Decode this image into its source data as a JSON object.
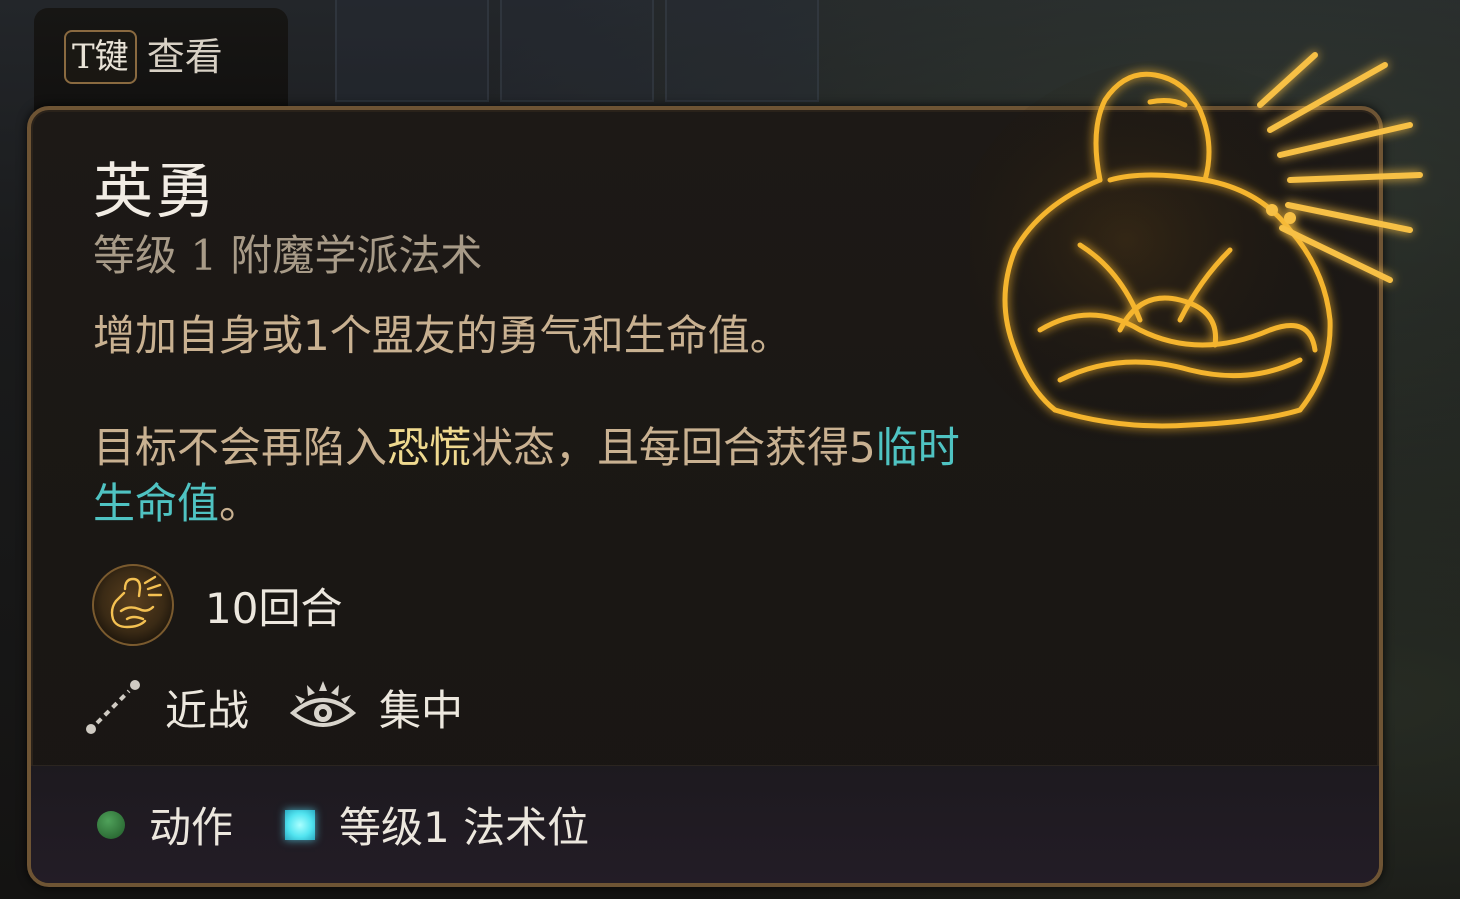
{
  "hotkey": {
    "key": "T键",
    "label": "查看"
  },
  "spell": {
    "name": "英勇",
    "subtitle": "等级 1 附魔学派法术",
    "description_line1": "增加自身或1个盟友的勇气和生命值。",
    "effect_part1": "目标不会再陷入",
    "effect_keyword1": "恐慌",
    "effect_part2": "状态，且每回合获得5",
    "effect_keyword2": "临时生命值",
    "effect_part3": "。",
    "duration": "10回合",
    "range": "近战",
    "concentration": "集中"
  },
  "cost": {
    "action": "动作",
    "slot": "等级1 法术位"
  },
  "colors": {
    "panel_border": "#6e5434",
    "title": "#f1ece4",
    "body_text": "#c9b191",
    "keyword_condition": "#efd98f",
    "keyword_hp": "#4fc3c2",
    "action_dot": "#3c8a46",
    "spell_slot": "#52e4f0",
    "art_glow": "#f5b52e"
  },
  "icons": {
    "art": "heroism-spell-art",
    "duration": "heroism-icon",
    "range": "melee-range-icon",
    "concentration": "concentration-eye-icon",
    "action": "action-dot-icon",
    "slot": "spell-slot-icon"
  }
}
